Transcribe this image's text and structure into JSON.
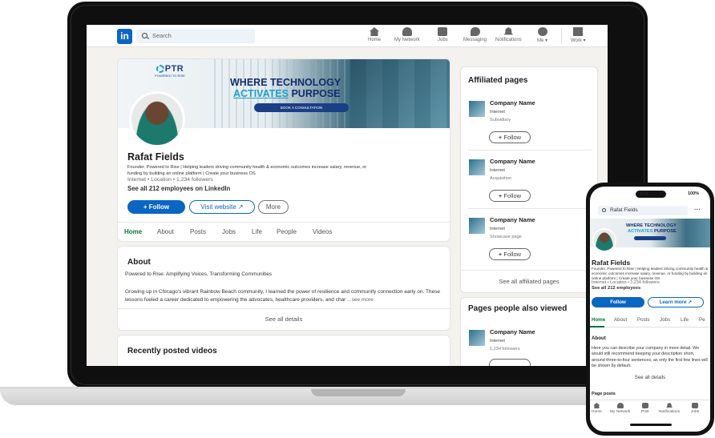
{
  "nav": {
    "logo": "in",
    "search_placeholder": "Search",
    "items": [
      {
        "label": "Home",
        "icon": "home-icon"
      },
      {
        "label": "My Network",
        "icon": "network-icon"
      },
      {
        "label": "Jobs",
        "icon": "briefcase-icon"
      },
      {
        "label": "Messaging",
        "icon": "message-icon"
      },
      {
        "label": "Notifications",
        "icon": "bell-icon"
      },
      {
        "label": "Me ▾",
        "icon": "avatar-icon"
      },
      {
        "label": "Work ▾",
        "icon": "grid-icon"
      }
    ]
  },
  "banner": {
    "logo_mark": "PTR",
    "logo_sub": "POWERED TO RISE",
    "line1": "WHERE TECHNOLOGY",
    "line2_accent": "ACTIVATES",
    "line2_rest": " PURPOSE",
    "cta": "BOOK A CONSULTATION"
  },
  "profile": {
    "name": "Rafat Fields",
    "tagline": "Founder, Powered to Rise | Helping leaders driving community health & economic outcomes increase salary, revenue, or funding by building an online platform | Create your business OS",
    "meta": "Internet • Location • 1,234 followers",
    "employees": "See all 212 employees on LinkedIn",
    "follow": "+ Follow",
    "visit": "Visit website ↗",
    "more": "More"
  },
  "tabs": [
    "Home",
    "About",
    "Posts",
    "Jobs",
    "Life",
    "People",
    "Videos"
  ],
  "about": {
    "title": "About",
    "subtitle": "Powered to Rise: Amplifying Voices, Transforming Communities",
    "body": "Growing up in Chicago's vibrant Rainbow Beach community, I learned the power of resilience and community connection early on. These lessons fueled a career dedicated to empowering the advocates, healthcare providers, and char",
    "see_more": "...see more",
    "see_all": "See all details"
  },
  "videos": {
    "title": "Recently posted videos"
  },
  "affiliated": {
    "title": "Affiliated pages",
    "items": [
      {
        "name": "Company Name",
        "industry": "Internet",
        "relation": "Subsidiary",
        "follow": "Follow"
      },
      {
        "name": "Company Name",
        "industry": "Internet",
        "relation": "Acquisition",
        "follow": "Follow"
      },
      {
        "name": "Company Name",
        "industry": "Internet",
        "relation": "Showcase page",
        "follow": "Follow"
      }
    ],
    "see_all": "See all affiliated pages"
  },
  "also_viewed": {
    "title": "Pages people also viewed",
    "items": [
      {
        "name": "Company Name",
        "industry": "Internet",
        "followers": "1,234 followers"
      }
    ]
  },
  "phone": {
    "time": "9:41",
    "signal": "100%",
    "search_value": "Rafat Fields",
    "line1": "WHERE TECHNOLOGY",
    "line2_accent": "ACTIVATES",
    "line2_rest": " PURPOSE",
    "name": "Rafat Fields",
    "bio": "Founder, Powered to Rise | Helping leaders driving community health & economic outcomes increase salary, revenue, or funding by building an online platform | Create your business OS",
    "meta": "Internet • Location • 1,234 followers",
    "employees": "See all 212 employees",
    "follow": "Follow",
    "learn_more": "Learn more ↗",
    "tabs": [
      "Home",
      "About",
      "Posts",
      "Jobs",
      "Life",
      "Pe"
    ],
    "about_title": "About",
    "about_body": "Here you can describe your company in more detail. We would still recommend keeping your description short, around three-to-four sentences, as only the first few lines will be shown by default.",
    "see_all": "See all details",
    "posts_title": "Page posts",
    "bottom_nav": [
      "Home",
      "My Network",
      "Post",
      "Notifications",
      "Jobs"
    ]
  }
}
